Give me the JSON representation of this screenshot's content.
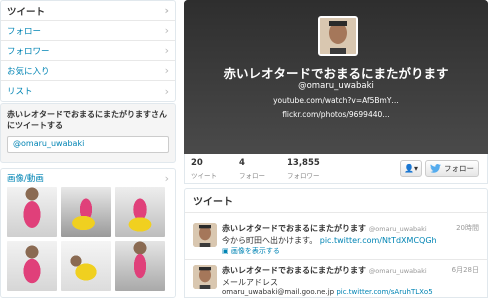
{
  "nav": {
    "items": [
      {
        "label": "ツイート"
      },
      {
        "label": "フォロー"
      },
      {
        "label": "フォロワー"
      },
      {
        "label": "お気に入り"
      },
      {
        "label": "リスト"
      }
    ]
  },
  "tweet_to": {
    "title": "赤いレオタードでおまるにまたがりますさんにツイートする",
    "value": "@omaru_uwabaki"
  },
  "media": {
    "title": "画像/動画"
  },
  "profile": {
    "name": "赤いレオタードでおまるにまたがります",
    "handle": "@omaru_uwabaki",
    "link1": "youtube.com/watch?v=Af5BmY…",
    "link2": "flickr.com/photos/9699440…"
  },
  "stats": [
    {
      "count": "20",
      "label": "ツイート"
    },
    {
      "count": "4",
      "label": "フォロー"
    },
    {
      "count": "13,855",
      "label": "フォロワー"
    }
  ],
  "actions": {
    "person_label": "👤▾",
    "follow_label": "フォロー"
  },
  "timeline": {
    "title": "ツイート",
    "tweets": [
      {
        "name": "赤いレオタードでおまるにまたがります",
        "handle": "@omaru_uwabaki",
        "time": "20時間",
        "text": "今から町田へ出かけます。",
        "link": "pic.twitter.com/NtTdXMCQGh",
        "media_link": "画像を表示する"
      },
      {
        "name": "赤いレオタードでおまるにまたがります",
        "handle": "@omaru_uwabaki",
        "time": "6月28日",
        "text": "メールアドレス",
        "line2": "omaru_uwabaki@mail.goo.ne.jp",
        "link": "pic.twitter.com/sAruhTLXo5"
      }
    ]
  },
  "colors": {
    "link": "#0084b4",
    "header_bg": "#3a3a3a",
    "leotard": "#e0407a"
  }
}
